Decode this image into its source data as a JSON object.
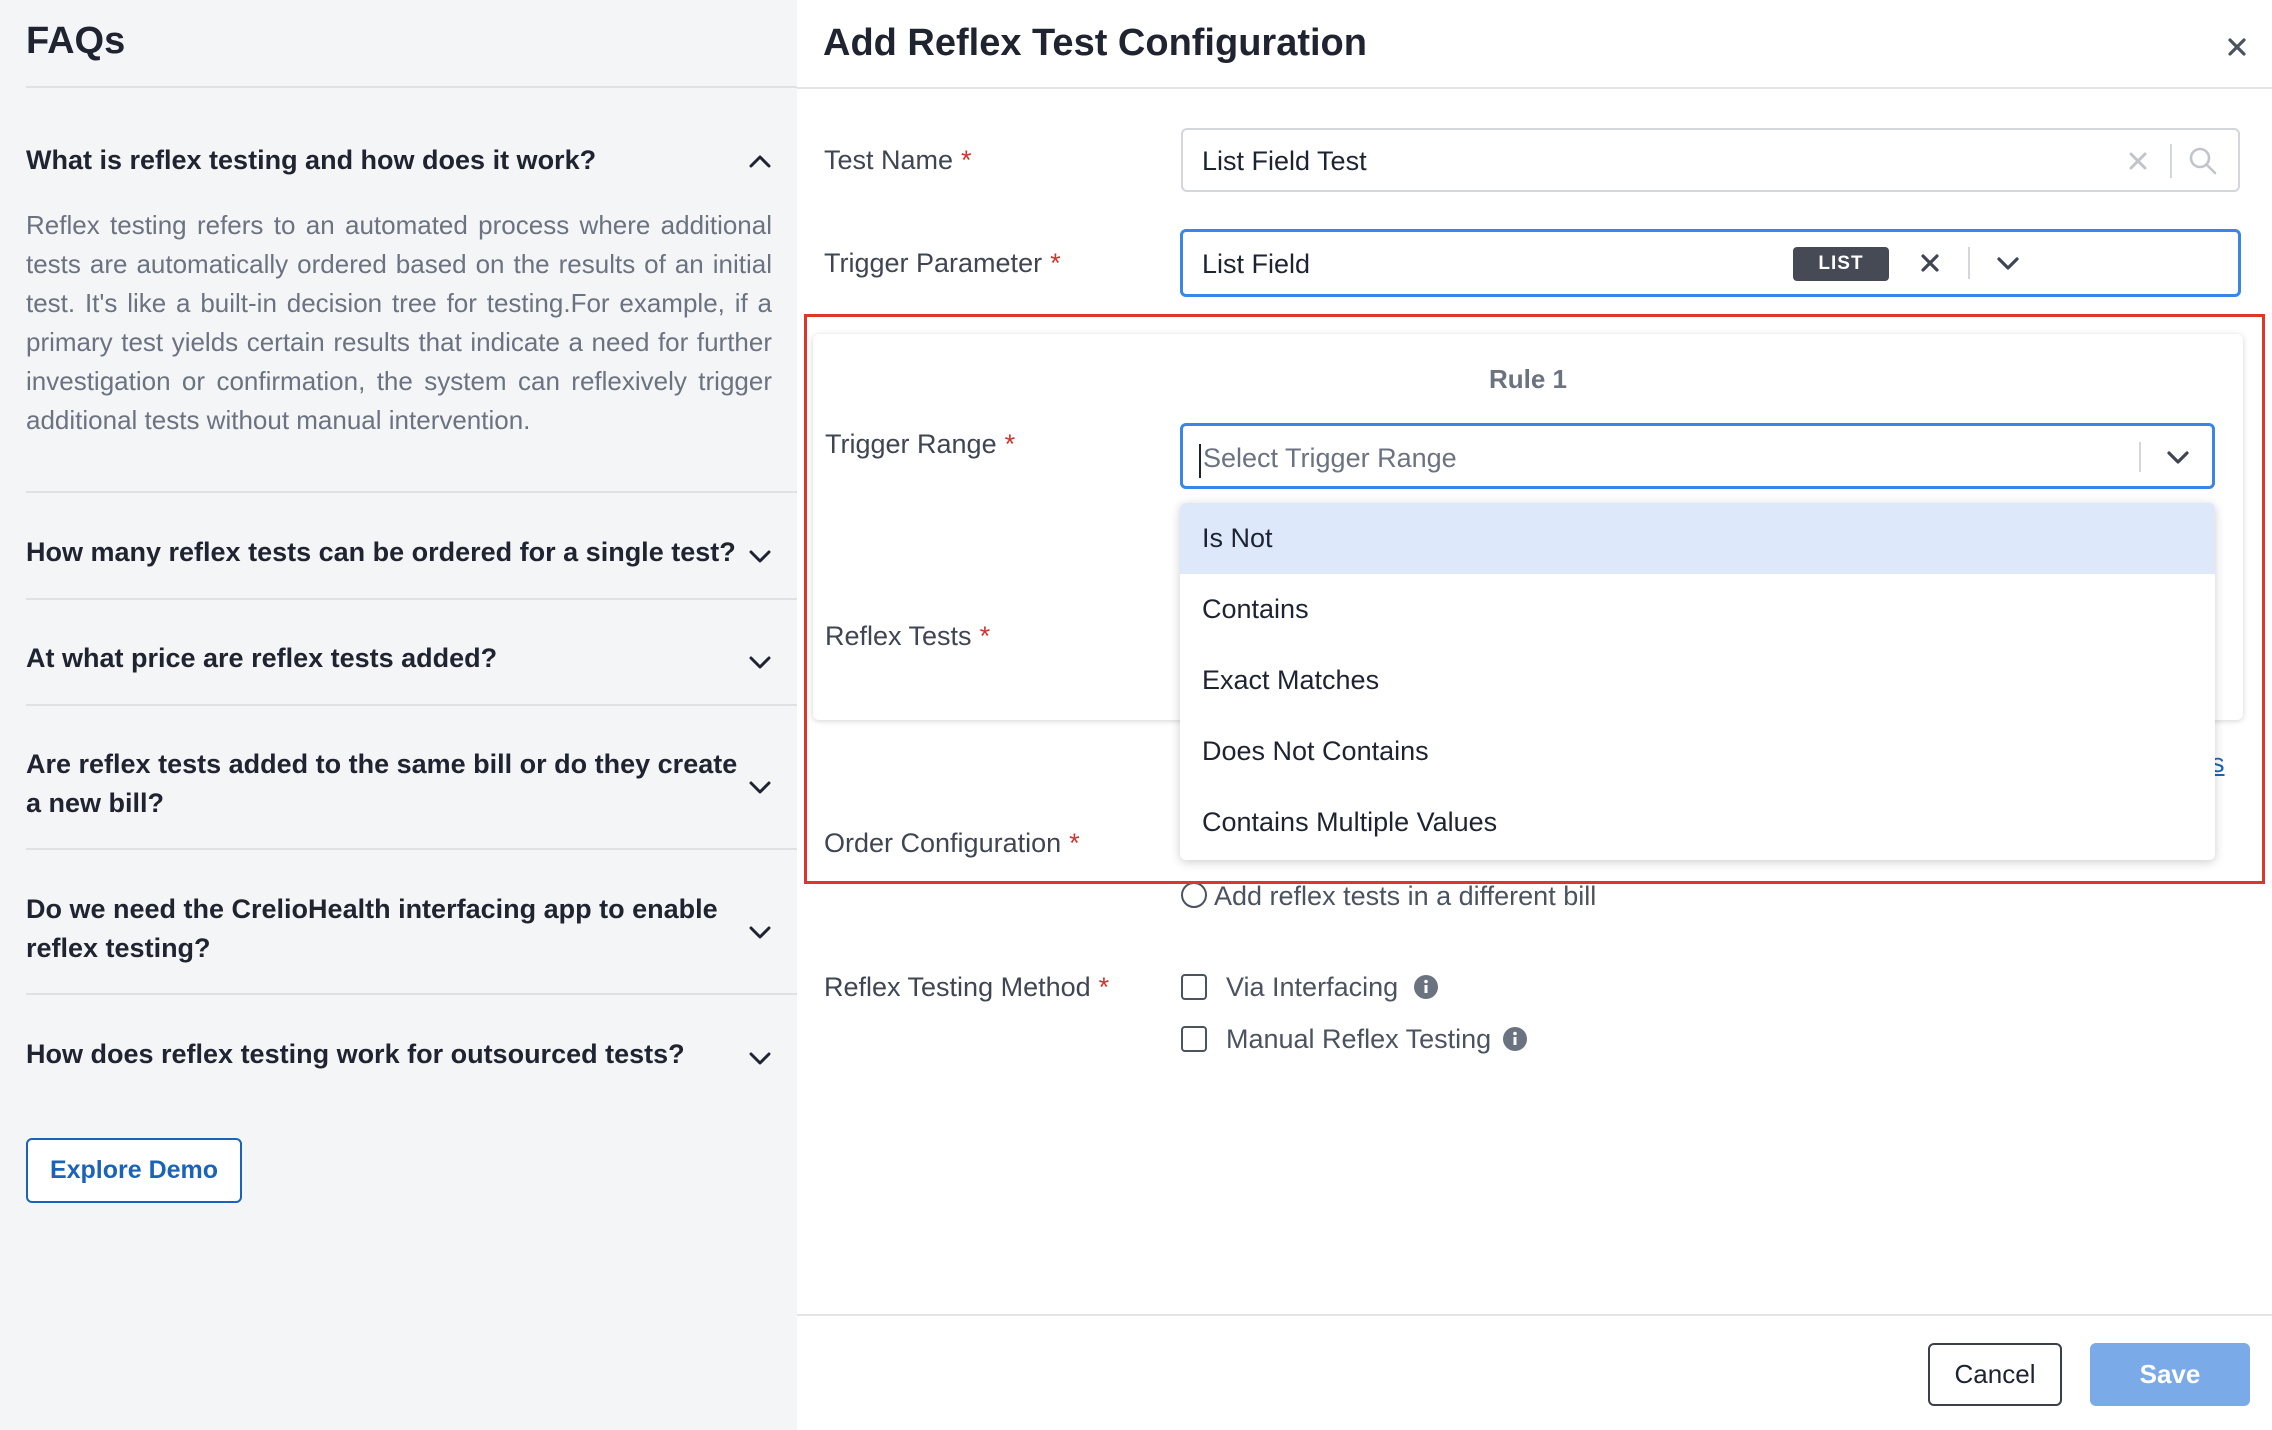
{
  "faq": {
    "title": "FAQs",
    "items": [
      {
        "question": "What is reflex testing and how does it work?",
        "answer": "Reflex testing refers to an automated process where additional tests are automatically ordered based on the results of an initial test. It's like a built-in decision tree for testing.For example, if a primary test yields certain results that indicate a need for further investigation or confirmation, the system can reflexively trigger additional tests without manual intervention.",
        "expanded": true
      },
      {
        "question": "How many reflex tests can be ordered for a single test?",
        "expanded": false
      },
      {
        "question": "At what price are reflex tests added?",
        "expanded": false
      },
      {
        "question": "Are reflex tests added to the same bill or do they create a new bill?",
        "expanded": false
      },
      {
        "question": "Do we need the CrelioHealth interfacing app to enable reflex testing?",
        "expanded": false
      },
      {
        "question": "How does reflex testing work for outsourced tests?",
        "expanded": false
      }
    ],
    "explore_demo_label": "Explore Demo"
  },
  "modal": {
    "title": "Add Reflex Test Configuration",
    "required_mark": "*",
    "test_name": {
      "label": "Test Name",
      "value": "List Field Test"
    },
    "trigger_parameter": {
      "label": "Trigger Parameter",
      "value": "List Field",
      "badge": "LIST"
    },
    "rule": {
      "title": "Rule 1",
      "trigger_range": {
        "label": "Trigger Range",
        "placeholder": "Select Trigger Range",
        "options": [
          "Is Not",
          "Contains",
          "Exact Matches",
          "Does Not Contains",
          "Contains Multiple Values"
        ],
        "highlighted_index": 0
      },
      "reflex_tests": {
        "label": "Reflex Tests"
      }
    },
    "peek_link_text": "s",
    "order_configuration": {
      "label": "Order Configuration",
      "visible_option": "Add reflex tests in a different bill"
    },
    "reflex_testing_method": {
      "label": "Reflex Testing Method",
      "options": [
        {
          "label": "Via Interfacing",
          "checked": false
        },
        {
          "label": "Manual Reflex Testing",
          "checked": false
        }
      ]
    },
    "cancel_label": "Cancel",
    "save_label": "Save"
  },
  "colors": {
    "primary": "#1a63b8",
    "focus_border": "#3a86e8",
    "required": "#d0342c",
    "highlight_box": "#e0352b",
    "save_disabled": "#7aaae8",
    "option_highlight": "#dde9fb"
  },
  "icons": [
    "chevron-up-icon",
    "chevron-down-icon",
    "close-icon",
    "clear-icon",
    "search-icon",
    "info-icon"
  ]
}
